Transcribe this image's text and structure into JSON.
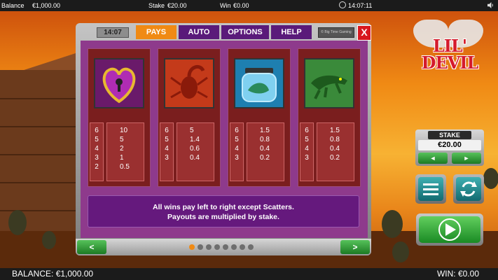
{
  "status_bar": {
    "balance_label": "Balance",
    "balance_value": "€1,000.00",
    "stake_label": "Stake",
    "stake_value": "€20.00",
    "win_label": "Win",
    "win_value": "€0.00",
    "time": "14:07:11"
  },
  "logo": {
    "text": "LIL' DEVIL"
  },
  "paytable": {
    "clock": "14:07",
    "tabs": [
      "PAYS",
      "AUTO",
      "OPTIONS",
      "HELP"
    ],
    "active_tab": "PAYS",
    "brand": "© Big Time Gaming",
    "close": "X",
    "symbols": [
      {
        "icon": "heart-lock-icon",
        "counts": [
          "6",
          "5",
          "4",
          "3",
          "2"
        ],
        "pays": [
          "10",
          "5",
          "2",
          "1",
          "0.5"
        ]
      },
      {
        "icon": "scorpion-icon",
        "counts": [
          "6",
          "5",
          "4",
          "3"
        ],
        "pays": [
          "5",
          "1.4",
          "0.6",
          "0.4"
        ]
      },
      {
        "icon": "lizard-jar-icon",
        "counts": [
          "6",
          "5",
          "4",
          "3"
        ],
        "pays": [
          "1.5",
          "0.8",
          "0.4",
          "0.2"
        ]
      },
      {
        "icon": "crocodile-icon",
        "counts": [
          "6",
          "5",
          "4",
          "3"
        ],
        "pays": [
          "1.5",
          "0.8",
          "0.4",
          "0.2"
        ]
      }
    ],
    "info_line1": "All wins pay left to right except Scatters.",
    "info_line2": "Payouts are multiplied by stake.",
    "pages": 8,
    "current_page": 1,
    "prev": "<",
    "next": ">"
  },
  "controls": {
    "stake_title": "STAKE",
    "stake_value": "€20.00",
    "decrease": "◄",
    "increase": "►"
  },
  "bottom_bar": {
    "balance": "BALANCE: €1,000.00",
    "win": "WIN: €0.00"
  },
  "colors": {
    "accent": "#f08a14",
    "tab_purple": "#5a1a7a",
    "close_red": "#d8171f",
    "button_green": "#1c7a23"
  }
}
